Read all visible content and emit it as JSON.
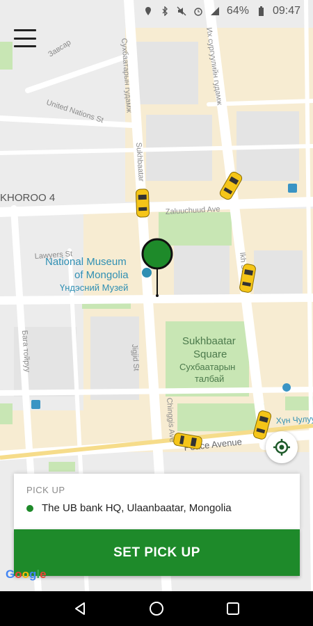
{
  "status_bar": {
    "battery": "64%",
    "time": "09:47"
  },
  "map": {
    "labels": {
      "zavsar": "Завсар",
      "un_st": "United Nations St",
      "sukhbaatar_gudamj": "Сухбаатарын гудамж",
      "surguuliin_gudamj": "Их сургуулийн гудамж",
      "sukhbaatar_latin": "Sukhbaatar",
      "khoroo": "KHOROO 4",
      "zaluuchuud": "Zaluuchuud Ave",
      "lawyers": "Lawyers St",
      "museum_en_1": "National Museum",
      "museum_en_2": "of Mongolia",
      "museum_mn": "Үндэсний Музей",
      "ikh_st": "Ikh St",
      "baga_toiruu": "Бага тойруу",
      "jigjid": "Jigjid St",
      "square_en_1": "Sukhbaatar",
      "square_en_2": "Square",
      "square_mn_1": "Сухбаатарын",
      "square_mn_2": "талбай",
      "chinggis": "Chinggis Ave",
      "peace_ave": "Peace Avenue",
      "khun_chul": "Хүн Чулуу"
    }
  },
  "pickup_card": {
    "label": "PICK UP",
    "address": "The UB bank HQ, Ulaanbaatar, Mongolia"
  },
  "cta": {
    "label": "SET PICK UP"
  },
  "google_logo": [
    "G",
    "o",
    "o",
    "g",
    "l",
    "e"
  ],
  "colors": {
    "accent": "#1e8a2a",
    "taxi": "#f5c518"
  }
}
